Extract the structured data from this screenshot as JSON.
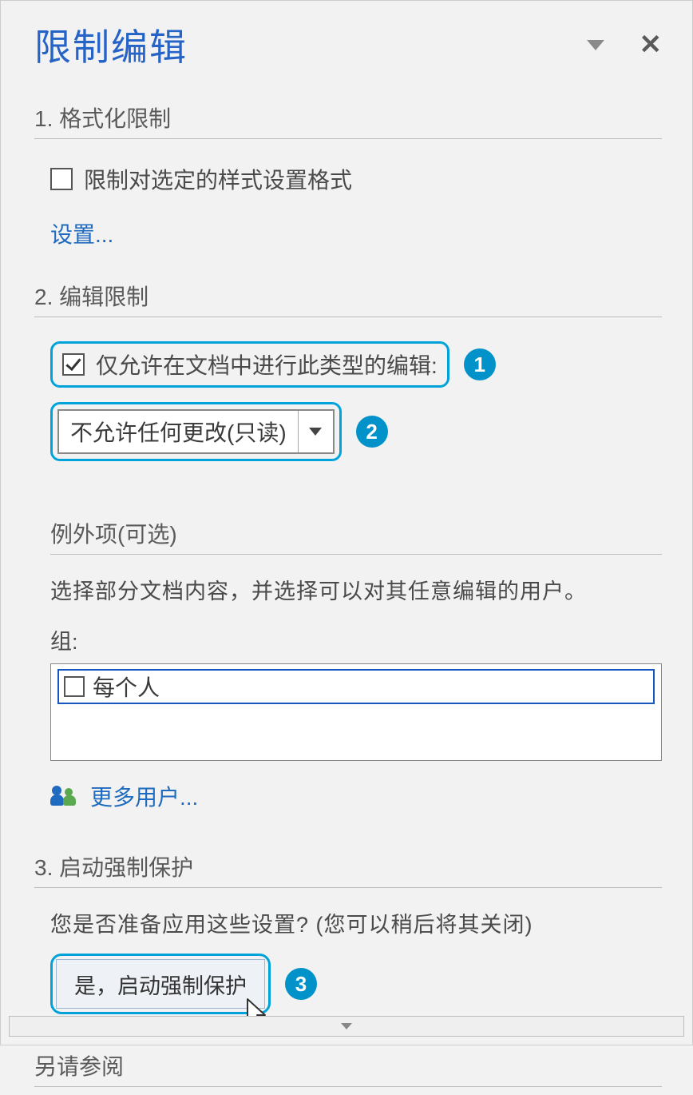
{
  "header": {
    "title": "限制编辑"
  },
  "section1": {
    "heading": "1. 格式化限制",
    "checkbox_label": "限制对选定的样式设置格式",
    "settings_link": "设置..."
  },
  "section2": {
    "heading": "2. 编辑限制",
    "checkbox_label": "仅允许在文档中进行此类型的编辑:",
    "dropdown_value": "不允许任何更改(只读)",
    "exceptions_heading": "例外项(可选)",
    "exceptions_text": "选择部分文档内容，并选择可以对其任意编辑的用户。",
    "group_label": "组:",
    "group_item": "每个人",
    "more_users": "更多用户..."
  },
  "section3": {
    "heading": "3. 启动强制保护",
    "prompt_text": "您是否准备应用这些设置? (您可以稍后将其关闭)",
    "button_label": "是，启动强制保护"
  },
  "see_also": "另请参阅",
  "callouts": {
    "n1": "1",
    "n2": "2",
    "n3": "3"
  }
}
